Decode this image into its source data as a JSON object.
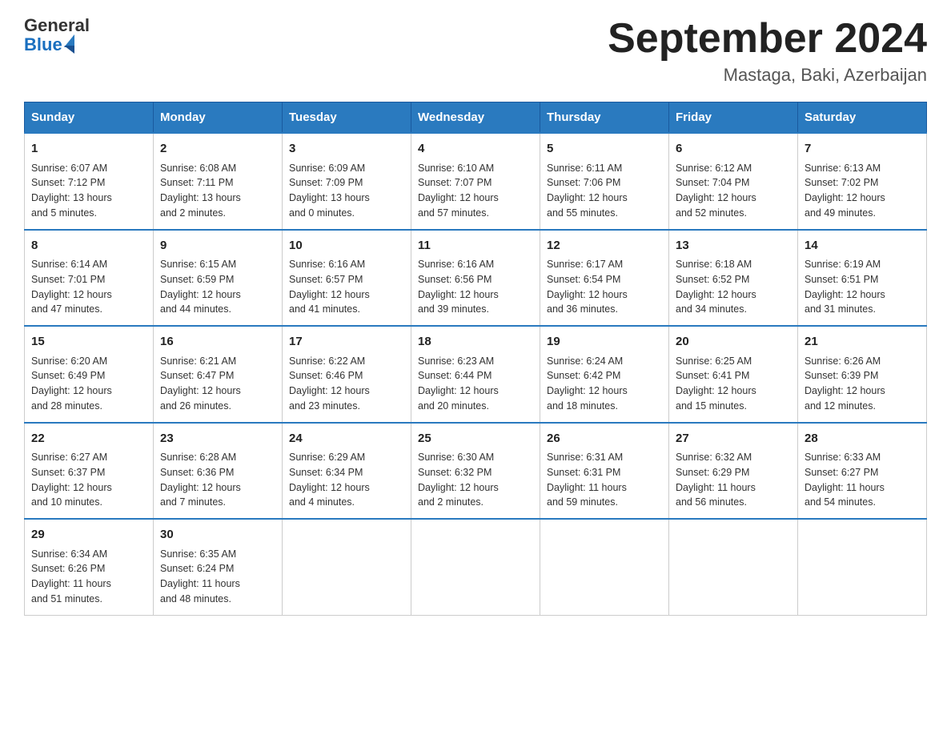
{
  "header": {
    "logo_general": "General",
    "logo_blue": "Blue",
    "month_title": "September 2024",
    "location": "Mastaga, Baki, Azerbaijan"
  },
  "days_of_week": [
    "Sunday",
    "Monday",
    "Tuesday",
    "Wednesday",
    "Thursday",
    "Friday",
    "Saturday"
  ],
  "weeks": [
    [
      {
        "day": "1",
        "sunrise": "6:07 AM",
        "sunset": "7:12 PM",
        "daylight": "13 hours and 5 minutes."
      },
      {
        "day": "2",
        "sunrise": "6:08 AM",
        "sunset": "7:11 PM",
        "daylight": "13 hours and 2 minutes."
      },
      {
        "day": "3",
        "sunrise": "6:09 AM",
        "sunset": "7:09 PM",
        "daylight": "13 hours and 0 minutes."
      },
      {
        "day": "4",
        "sunrise": "6:10 AM",
        "sunset": "7:07 PM",
        "daylight": "12 hours and 57 minutes."
      },
      {
        "day": "5",
        "sunrise": "6:11 AM",
        "sunset": "7:06 PM",
        "daylight": "12 hours and 55 minutes."
      },
      {
        "day": "6",
        "sunrise": "6:12 AM",
        "sunset": "7:04 PM",
        "daylight": "12 hours and 52 minutes."
      },
      {
        "day": "7",
        "sunrise": "6:13 AM",
        "sunset": "7:02 PM",
        "daylight": "12 hours and 49 minutes."
      }
    ],
    [
      {
        "day": "8",
        "sunrise": "6:14 AM",
        "sunset": "7:01 PM",
        "daylight": "12 hours and 47 minutes."
      },
      {
        "day": "9",
        "sunrise": "6:15 AM",
        "sunset": "6:59 PM",
        "daylight": "12 hours and 44 minutes."
      },
      {
        "day": "10",
        "sunrise": "6:16 AM",
        "sunset": "6:57 PM",
        "daylight": "12 hours and 41 minutes."
      },
      {
        "day": "11",
        "sunrise": "6:16 AM",
        "sunset": "6:56 PM",
        "daylight": "12 hours and 39 minutes."
      },
      {
        "day": "12",
        "sunrise": "6:17 AM",
        "sunset": "6:54 PM",
        "daylight": "12 hours and 36 minutes."
      },
      {
        "day": "13",
        "sunrise": "6:18 AM",
        "sunset": "6:52 PM",
        "daylight": "12 hours and 34 minutes."
      },
      {
        "day": "14",
        "sunrise": "6:19 AM",
        "sunset": "6:51 PM",
        "daylight": "12 hours and 31 minutes."
      }
    ],
    [
      {
        "day": "15",
        "sunrise": "6:20 AM",
        "sunset": "6:49 PM",
        "daylight": "12 hours and 28 minutes."
      },
      {
        "day": "16",
        "sunrise": "6:21 AM",
        "sunset": "6:47 PM",
        "daylight": "12 hours and 26 minutes."
      },
      {
        "day": "17",
        "sunrise": "6:22 AM",
        "sunset": "6:46 PM",
        "daylight": "12 hours and 23 minutes."
      },
      {
        "day": "18",
        "sunrise": "6:23 AM",
        "sunset": "6:44 PM",
        "daylight": "12 hours and 20 minutes."
      },
      {
        "day": "19",
        "sunrise": "6:24 AM",
        "sunset": "6:42 PM",
        "daylight": "12 hours and 18 minutes."
      },
      {
        "day": "20",
        "sunrise": "6:25 AM",
        "sunset": "6:41 PM",
        "daylight": "12 hours and 15 minutes."
      },
      {
        "day": "21",
        "sunrise": "6:26 AM",
        "sunset": "6:39 PM",
        "daylight": "12 hours and 12 minutes."
      }
    ],
    [
      {
        "day": "22",
        "sunrise": "6:27 AM",
        "sunset": "6:37 PM",
        "daylight": "12 hours and 10 minutes."
      },
      {
        "day": "23",
        "sunrise": "6:28 AM",
        "sunset": "6:36 PM",
        "daylight": "12 hours and 7 minutes."
      },
      {
        "day": "24",
        "sunrise": "6:29 AM",
        "sunset": "6:34 PM",
        "daylight": "12 hours and 4 minutes."
      },
      {
        "day": "25",
        "sunrise": "6:30 AM",
        "sunset": "6:32 PM",
        "daylight": "12 hours and 2 minutes."
      },
      {
        "day": "26",
        "sunrise": "6:31 AM",
        "sunset": "6:31 PM",
        "daylight": "11 hours and 59 minutes."
      },
      {
        "day": "27",
        "sunrise": "6:32 AM",
        "sunset": "6:29 PM",
        "daylight": "11 hours and 56 minutes."
      },
      {
        "day": "28",
        "sunrise": "6:33 AM",
        "sunset": "6:27 PM",
        "daylight": "11 hours and 54 minutes."
      }
    ],
    [
      {
        "day": "29",
        "sunrise": "6:34 AM",
        "sunset": "6:26 PM",
        "daylight": "11 hours and 51 minutes."
      },
      {
        "day": "30",
        "sunrise": "6:35 AM",
        "sunset": "6:24 PM",
        "daylight": "11 hours and 48 minutes."
      },
      null,
      null,
      null,
      null,
      null
    ]
  ],
  "labels": {
    "sunrise": "Sunrise:",
    "sunset": "Sunset:",
    "daylight": "Daylight:"
  }
}
